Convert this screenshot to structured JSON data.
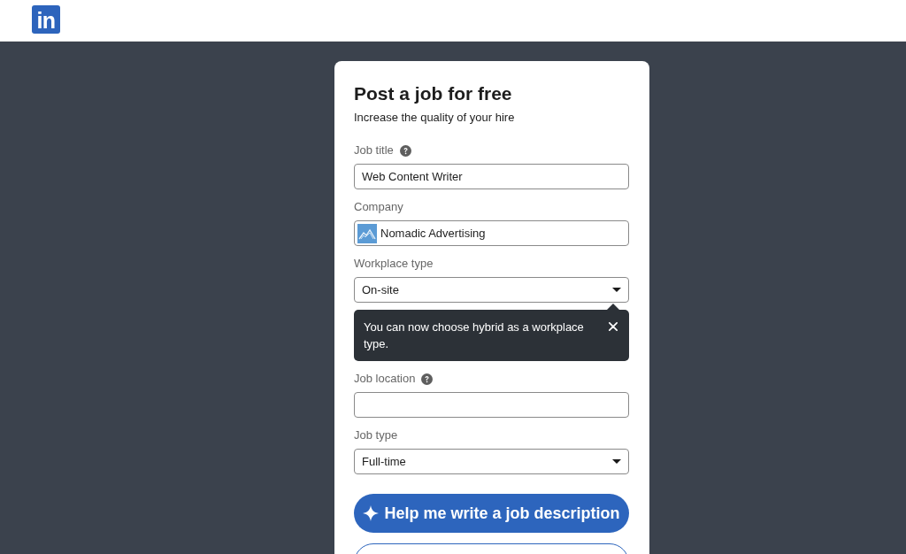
{
  "header": {
    "logo_text": "in"
  },
  "form": {
    "title": "Post a job for free",
    "subtitle": "Increase the quality of your hire",
    "fields": [
      {
        "kind": "text",
        "label": "Job title",
        "help": true,
        "value": "Web Content Writer"
      },
      {
        "kind": "company",
        "label": "Company",
        "help": false,
        "value": "Nomadic Advertising"
      },
      {
        "kind": "select",
        "label": "Workplace type",
        "help": false,
        "value": "On-site",
        "tooltip": "You can now choose hybrid as a workplace type."
      },
      {
        "kind": "text",
        "label": "Job location",
        "help": true
      },
      {
        "kind": "select",
        "label": "Job type",
        "help": false,
        "value": "Full-time"
      }
    ],
    "buttons": [
      {
        "kind": "primary",
        "label": "Help me write a job description"
      },
      {
        "kind": "outline"
      }
    ]
  }
}
